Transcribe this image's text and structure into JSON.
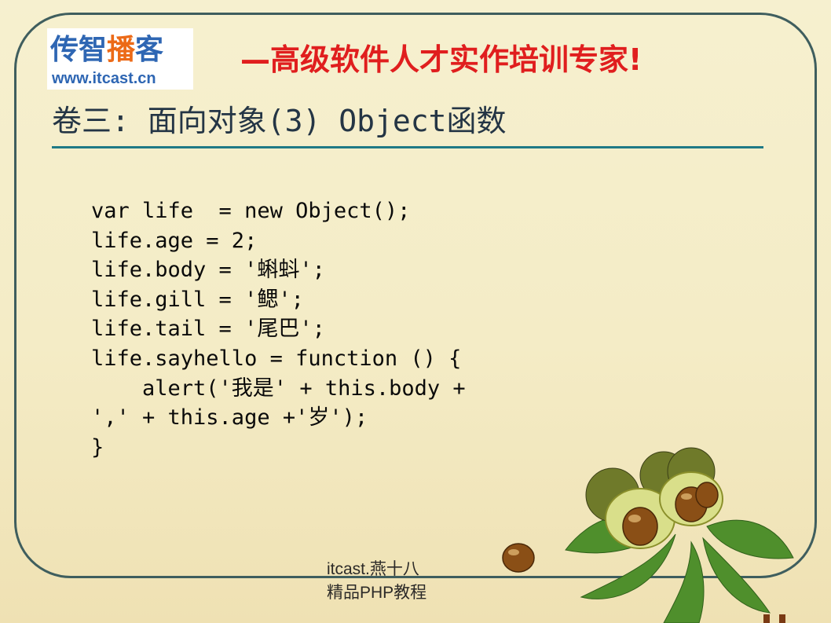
{
  "logo": {
    "brand_blue": "传智",
    "brand_orange": "播",
    "brand_blue_end": "客",
    "url": "www.itcast.cn"
  },
  "header": {
    "slogan": "—高级软件人才实作培训专家!"
  },
  "slide": {
    "title": "卷三: 面向对象(3) Object函数",
    "code_lines": [
      "var life  = new Object();",
      "life.age = 2;",
      "life.body = '蝌蚪';",
      "life.gill = '鳃';",
      "life.tail = '尾巴';",
      "life.sayhello = function () {",
      "    alert('我是' + this.body +",
      "',' + this.age +'岁');",
      "}"
    ]
  },
  "footer": {
    "line1": "itcast.燕十八",
    "line2": "精品PHP教程"
  },
  "colors": {
    "frame": "#3f5e5e",
    "rule": "#1f7a86",
    "slogan": "#e01e1e",
    "logo_blue": "#2e66b3",
    "logo_orange": "#ec6a17"
  }
}
